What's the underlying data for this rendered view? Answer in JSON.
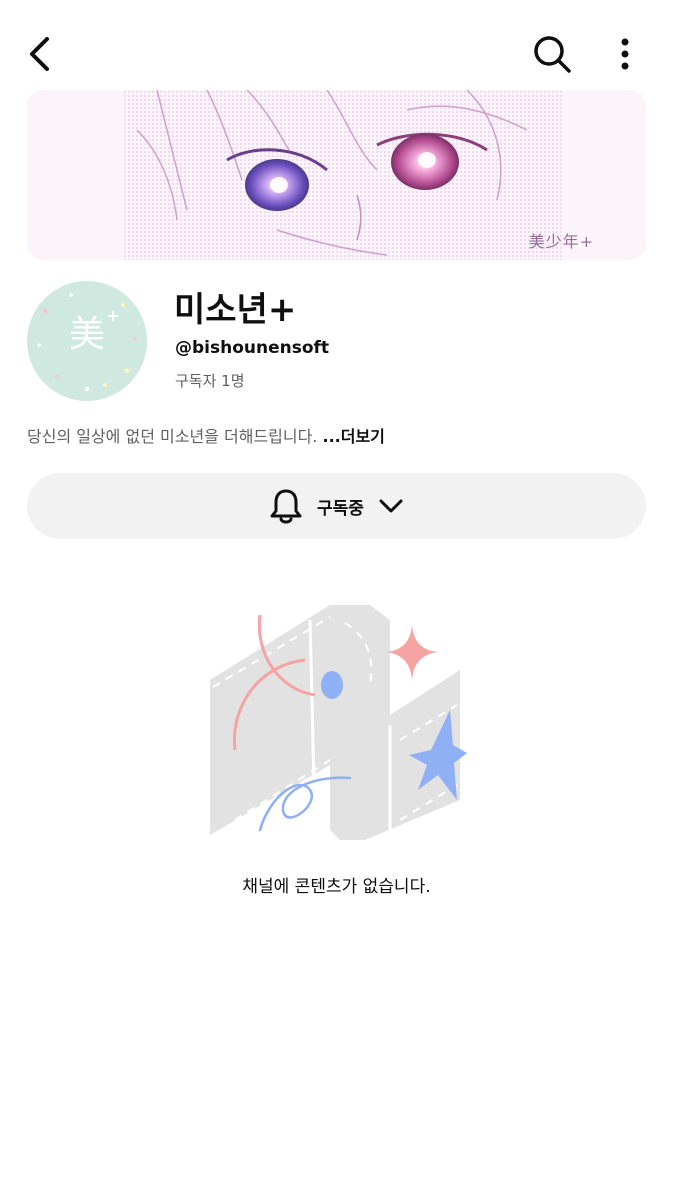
{
  "header": {
    "back_icon": "back-arrow-icon",
    "search_icon": "search-icon",
    "more_icon": "more-vertical-icon"
  },
  "banner": {
    "logo_text": "美少年+"
  },
  "avatar": {
    "logo_char": "美",
    "logo_sub1": "",
    "logo_sub2": ""
  },
  "channel": {
    "title": "미소년+",
    "handle": "@bishounensoft",
    "subscribers": "구독자 1명",
    "description": "당신의 일상에 없던 미소년을 더해드립니다.",
    "more_label": "...더보기"
  },
  "subscribe": {
    "bell_icon": "bell-icon",
    "label": "구독중",
    "chevron_icon": "chevron-down-icon"
  },
  "empty_state": {
    "message": "채널에 콘텐츠가 없습니다."
  },
  "colors": {
    "accent_pink": "#f5a3a3",
    "accent_blue": "#8fb0f5",
    "button_bg": "#f2f2f2",
    "text_secondary": "#606060"
  }
}
